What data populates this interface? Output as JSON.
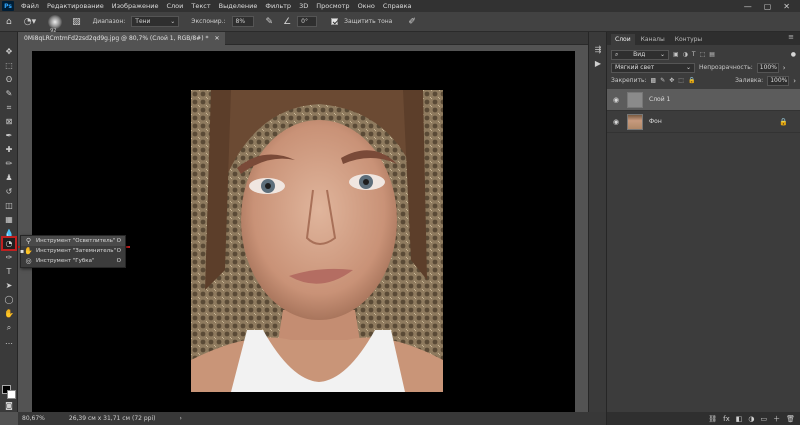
{
  "menu": {
    "logo": "Ps",
    "items": [
      "Файл",
      "Редактирование",
      "Изображение",
      "Слои",
      "Текст",
      "Выделение",
      "Фильтр",
      "3D",
      "Просмотр",
      "Окно",
      "Справка"
    ],
    "window_controls": [
      "—",
      "▢",
      "✕"
    ]
  },
  "options": {
    "brush_size": "92",
    "range_label": "Диапазон:",
    "range_value": "Тени",
    "exposure_label": "Экспонир.:",
    "exposure_value": "8%",
    "angle_value": "0°",
    "protect_tones_label": "Защитить тона"
  },
  "document": {
    "tab_title": "0Mi8qLRCmtmFd2zsd2qd9g.jpg @ 80,7% (Слой 1, RGB/8#) *",
    "close": "✕"
  },
  "flyout": {
    "items": [
      {
        "label": "Инструмент \"Осветлитель\"",
        "key": "O",
        "icon": "🔍"
      },
      {
        "label": "Инструмент \"Затемнитель\"",
        "key": "O",
        "icon": "✋"
      },
      {
        "label": "Инструмент \"Губка\"",
        "key": "O",
        "icon": "◎"
      }
    ]
  },
  "layers_panel": {
    "tabs": [
      "Слои",
      "Каналы",
      "Контуры"
    ],
    "filter_label": "Вид",
    "blend_mode": "Мягкий свет",
    "opacity_label": "Непрозрачность:",
    "opacity_value": "100%",
    "lock_label": "Закрепить:",
    "fill_label": "Заливка:",
    "fill_value": "100%",
    "layers": [
      {
        "name": "Слой 1",
        "selected": true
      },
      {
        "name": "Фон",
        "selected": false
      }
    ],
    "footer_icons": [
      "⛓",
      "fx",
      "◧",
      "◑",
      "▭",
      "＋",
      "🗑"
    ]
  },
  "status": {
    "zoom": "80,67%",
    "doc_size": "26,39 см x 31,71 см (72 ppi)"
  }
}
